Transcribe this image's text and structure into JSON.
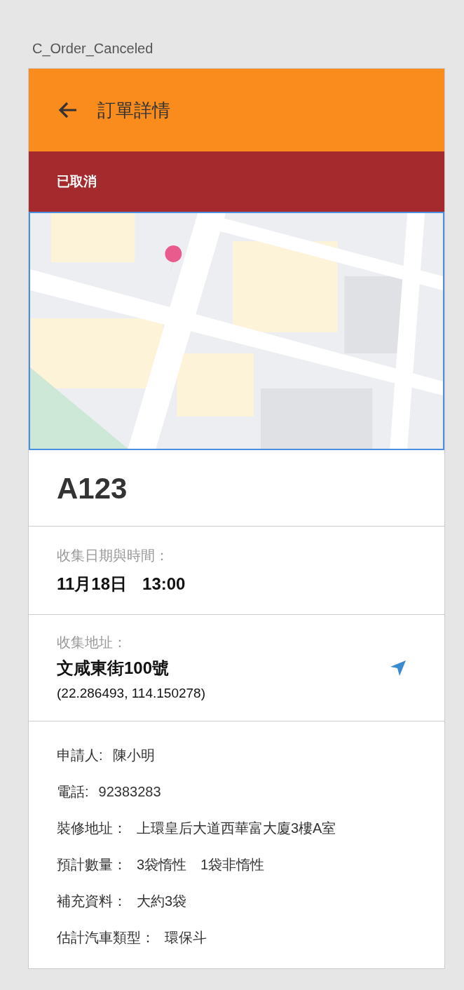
{
  "artboard_label": "C_Order_Canceled",
  "header": {
    "title": "訂單詳情"
  },
  "status_banner": {
    "text": "已取消",
    "kind": "canceled"
  },
  "order": {
    "code": "A123"
  },
  "collection_time": {
    "label": "收集日期與時間：",
    "date": "11月18日",
    "time": "13:00"
  },
  "collection_address": {
    "label": "收集地址：",
    "address": "文咸東街100號",
    "coordinates": "(22.286493, 114.150278)"
  },
  "details": [
    {
      "label": "申請人:",
      "value": "陳小明"
    },
    {
      "label": "電話:",
      "value": "92383283"
    },
    {
      "label": "裝修地址：",
      "value": "上環皇后大道西華富大廈3樓A室"
    },
    {
      "label": "預計數量：",
      "value": "3袋惰性　1袋非惰性"
    },
    {
      "label": "補充資料：",
      "value": "大約3袋"
    },
    {
      "label": "估計汽車類型：",
      "value": "環保斗"
    }
  ]
}
